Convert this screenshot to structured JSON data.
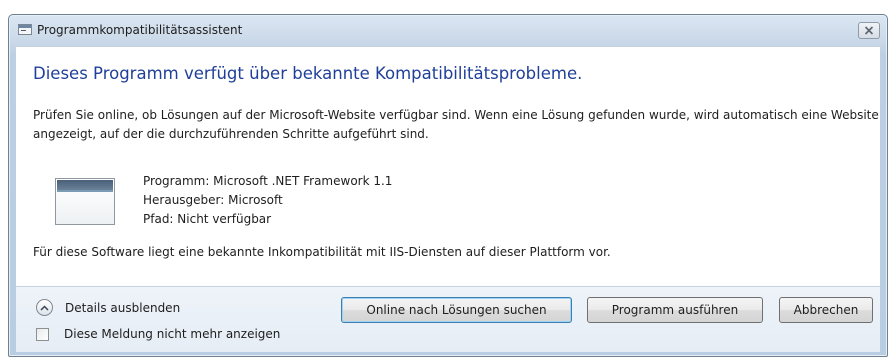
{
  "window": {
    "title": "Programmkompatibilitätsassistent"
  },
  "content": {
    "heading": "Dieses Programm verfügt über bekannte Kompatibilitätsprobleme.",
    "description": "Prüfen Sie online, ob Lösungen auf der Microsoft-Website verfügbar sind. Wenn eine Lösung gefunden wurde, wird automatisch eine Website angezeigt, auf der die durchzuführenden Schritte aufgeführt sind.",
    "program_info": {
      "program": "Programm: Microsoft .NET Framework 1.1",
      "publisher": "Herausgeber: Microsoft",
      "path": "Pfad: Nicht verfügbar"
    },
    "note": "Für diese Software liegt eine bekannte Inkompatibilität mit IIS-Diensten auf dieser Plattform vor."
  },
  "footer": {
    "details_label": "Details ausblenden",
    "checkbox_label": "Diese Meldung nicht mehr anzeigen",
    "checkbox_checked": false,
    "buttons": {
      "online": "Online nach Lösungen suchen",
      "run": "Programm ausführen",
      "cancel": "Abbrechen"
    }
  },
  "icons": {
    "app": "window-app-icon",
    "close": "close-icon",
    "program": "program-window-icon",
    "details": "chevron-up-icon"
  }
}
